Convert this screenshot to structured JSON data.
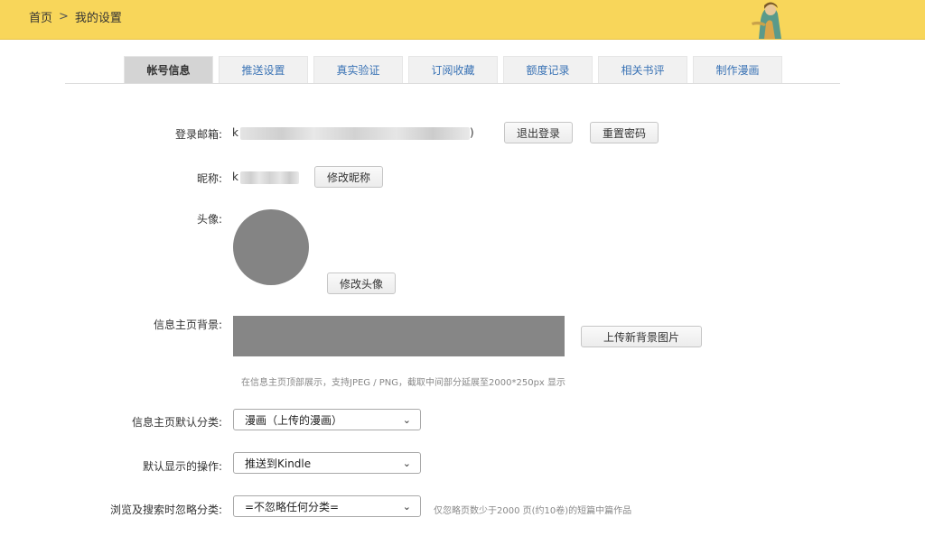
{
  "header": {
    "breadcrumb": {
      "home": "首页",
      "separator": ">",
      "current": "我的设置"
    },
    "bg_color": "#f8d65a"
  },
  "tabs": [
    {
      "label": "帐号信息",
      "active": true
    },
    {
      "label": "推送设置",
      "active": false
    },
    {
      "label": "真实验证",
      "active": false
    },
    {
      "label": "订阅收藏",
      "active": false
    },
    {
      "label": "额度记录",
      "active": false
    },
    {
      "label": "相关书评",
      "active": false
    },
    {
      "label": "制作漫画",
      "active": false
    }
  ],
  "account": {
    "email_label": "登录邮箱:",
    "email_prefix": "k",
    "email_suffix": ")",
    "logout_button": "退出登录",
    "reset_password_button": "重置密码",
    "nickname_label": "昵称:",
    "nickname_prefix": "k",
    "edit_nickname_button": "修改昵称",
    "avatar_label": "头像:",
    "edit_avatar_button": "修改头像",
    "profile_bg_label": "信息主页背景:",
    "upload_bg_button": "上传新背景图片",
    "bg_hint": "在信息主页顶部展示，支持JPEG / PNG，截取中间部分延展至2000*250px 显示",
    "default_category_label": "信息主页默认分类:",
    "default_category_value": "漫画（上传的漫画）",
    "default_action_label": "默认显示的操作:",
    "default_action_value": "推送到Kindle",
    "ignore_category_label": "浏览及搜索时忽略分类:",
    "ignore_category_value": "=不忽略任何分类=",
    "ignore_hint": "仅忽略页数少于2000 页(约10卷)的短篇中篇作品"
  }
}
